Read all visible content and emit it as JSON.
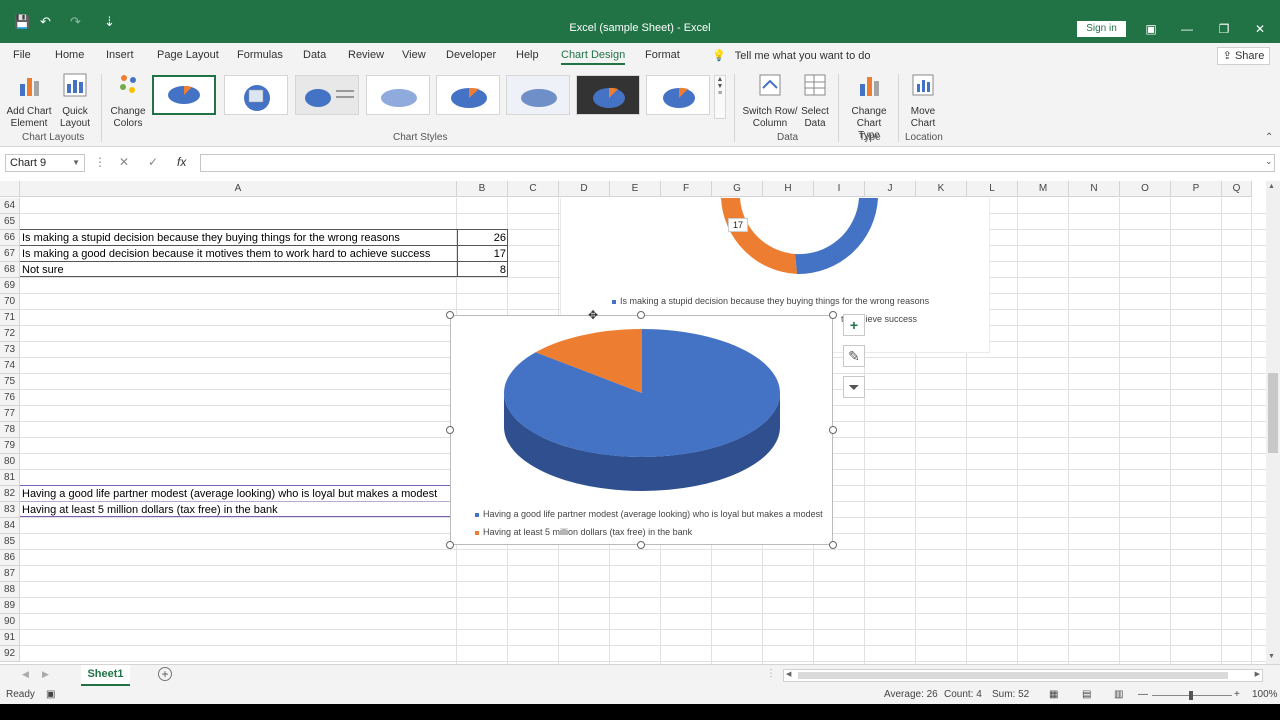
{
  "titlebar": {
    "title": "Excel (sample Sheet)  -  Excel",
    "signin": "Sign in",
    "qa_save": "💾",
    "qa_undo": "↶",
    "qa_redo": "↷",
    "qa_customize": "⇣"
  },
  "tabs": [
    "File",
    "Home",
    "Insert",
    "Page Layout",
    "Formulas",
    "Data",
    "Review",
    "View",
    "Developer",
    "Help",
    "Chart Design",
    "Format"
  ],
  "active_tab": "Chart Design",
  "tell_me": "Tell me what you want to do",
  "share": "Share",
  "ribbon": {
    "add_chart_element": "Add Chart Element",
    "quick_layout": "Quick Layout",
    "change_colors": "Change Colors",
    "chart_layouts_label": "Chart Layouts",
    "chart_styles_label": "Chart Styles",
    "switch_row_col": "Switch Row/ Column",
    "select_data": "Select Data",
    "data_label": "Data",
    "change_chart_type": "Change Chart Type",
    "type_label": "Type",
    "move_chart": "Move Chart",
    "location_label": "Location"
  },
  "namebox": "Chart 9",
  "formula": "",
  "columns": [
    "A",
    "B",
    "C",
    "D",
    "E",
    "F",
    "G",
    "H",
    "I",
    "J",
    "K",
    "L",
    "M",
    "N",
    "O",
    "P",
    "Q"
  ],
  "rows": [
    64,
    65,
    66,
    67,
    68,
    69,
    70,
    71,
    72,
    73,
    74,
    75,
    76,
    77,
    78,
    79,
    80,
    81,
    82,
    83,
    84,
    85,
    86,
    87,
    88,
    89,
    90,
    91,
    92
  ],
  "cells": {
    "a66": "Is making a stupid decision because they buying things for the wrong reasons",
    "b66": "26",
    "a67": "Is making a good decision because it motives them to work hard to achieve success",
    "b67": "17",
    "a68": "Not sure",
    "b68": "8",
    "a82": "Having a good life partner modest (average looking) who is loyal but makes a modest",
    "a83": "Having at least 5 million dollars (tax free) in the bank"
  },
  "donut_chart": {
    "label_17": "17",
    "legend_1": "Is making a stupid decision because they buying things for the wrong reasons",
    "legend_2_partial": "to achieve success"
  },
  "chart_data": {
    "type": "pie",
    "categories": [
      "Having a good life partner modest (average looking) who is loyal but makes a modest",
      "Having at least 5 million dollars (tax free) in the bank"
    ],
    "values": [
      86,
      14
    ],
    "colors": [
      "#4472c4",
      "#ed7d31"
    ],
    "legend": "bottom"
  },
  "sheet_tab": "Sheet1",
  "status": {
    "ready": "Ready",
    "average": "Average: 26",
    "count": "Count: 4",
    "sum": "Sum: 52",
    "zoom": "100%"
  }
}
